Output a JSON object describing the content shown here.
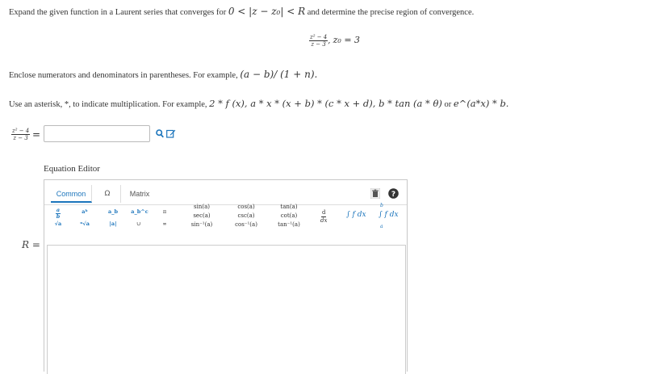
{
  "instruction": {
    "text": "Expand the given function in a Laurent series that converges for",
    "condition": "0 < |z − z₀| < R",
    "tail": "and determine the precise region of convergence."
  },
  "function": {
    "numerator": "z² − 4",
    "denominator": "z − 3",
    "center_label": "z₀ = 3"
  },
  "hint_parentheses": {
    "text": "Enclose numerators and denominators in parentheses. For example,",
    "example": "(a − b)/ (1 + n)."
  },
  "hint_asterisk": {
    "text": "Use an asterisk, *, to indicate multiplication. For example,",
    "example": "2 * f (x), a * x * (x + b) * (c * x + d), b * tan (a * θ)",
    "or": "or",
    "example2": "e^(a*x) * b."
  },
  "answer": {
    "lhs_num": "z² − 4",
    "lhs_den": "z − 3",
    "equals": "=",
    "value": ""
  },
  "equation_editor": {
    "title": "Equation Editor",
    "tabs": [
      "Common",
      "Ω",
      "Matrix"
    ],
    "active_tab": "Common",
    "palette": {
      "frac": "a/b",
      "power": "aᵇ",
      "subscript": "a_b",
      "subsup": "a_b^c",
      "pi": "π",
      "sqrt": "√a",
      "nroot": "ⁿ√a",
      "abs": "|a|",
      "union": "∪",
      "infinity": "∞",
      "trig1": [
        "sin(a)",
        "sec(a)",
        "sin⁻¹(a)"
      ],
      "trig2": [
        "cos(a)",
        "csc(a)",
        "cos⁻¹(a)"
      ],
      "trig3": [
        "tan(a)",
        "cot(a)",
        "tan⁻¹(a)"
      ],
      "deriv_num": "d",
      "deriv_den": "dx",
      "integral": "∫ f dx",
      "def_integral": "∫ f dx",
      "int_upper": "b",
      "int_lower": "a"
    }
  },
  "radius_label": "R =",
  "colors": {
    "accent": "#1c75bc",
    "border": "#c8c8c8"
  },
  "icons": [
    "search-icon",
    "edit-icon",
    "trash-icon",
    "help-icon"
  ]
}
